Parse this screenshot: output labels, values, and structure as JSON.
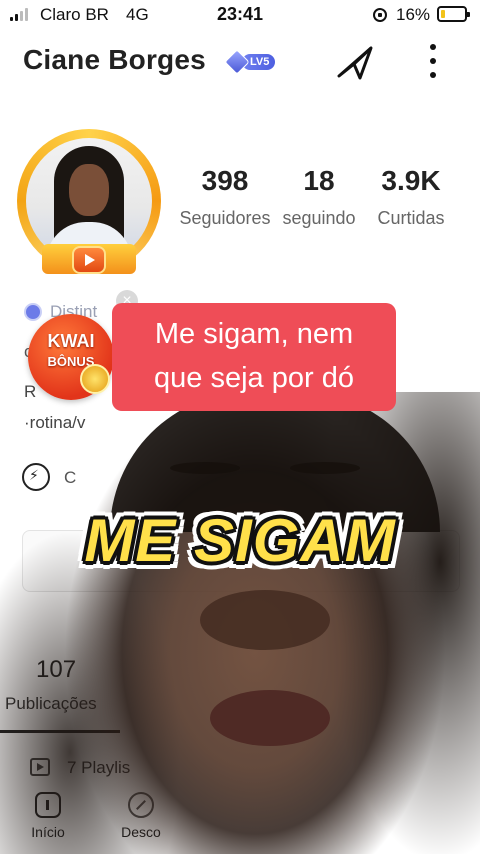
{
  "status_bar": {
    "carrier": "Claro BR",
    "network": "4G",
    "time": "23:41",
    "battery_percent": "16%",
    "battery_level": 0.16,
    "battery_color": "#f2c31a"
  },
  "header": {
    "name": "Ciane Borges",
    "level_badge": "LV5",
    "share_icon": "share-arrow-icon",
    "more_icon": "vertical-dots-icon"
  },
  "stats": [
    {
      "value": "398",
      "label": "Seguidores"
    },
    {
      "value": "18",
      "label": "seguindo"
    },
    {
      "value": "3.9K",
      "label": "Curtidas"
    }
  ],
  "bio": {
    "distinction_label": "Distint",
    "line1": "c",
    "line2": "R",
    "line3": "·rotina/v"
  },
  "kwai_bonus": {
    "line1": "KWAI",
    "line2": "BÔNUS",
    "close_glyph": "×"
  },
  "bolt_row": {
    "label": "C"
  },
  "publications": {
    "count": "107",
    "label": "Publicações",
    "playlists_label": "7 Playlis"
  },
  "bottom_nav": [
    {
      "label": "Início",
      "icon": "home-icon"
    },
    {
      "label": "Desco",
      "icon": "discover-icon"
    }
  ],
  "video_overlay": {
    "caption_line1": "Me sigam, nem",
    "caption_line2": "que seja por dó",
    "caption_bg": "#ef4d57",
    "big_caption": "ME SIGAM",
    "big_caption_color": "#ffe04a"
  }
}
